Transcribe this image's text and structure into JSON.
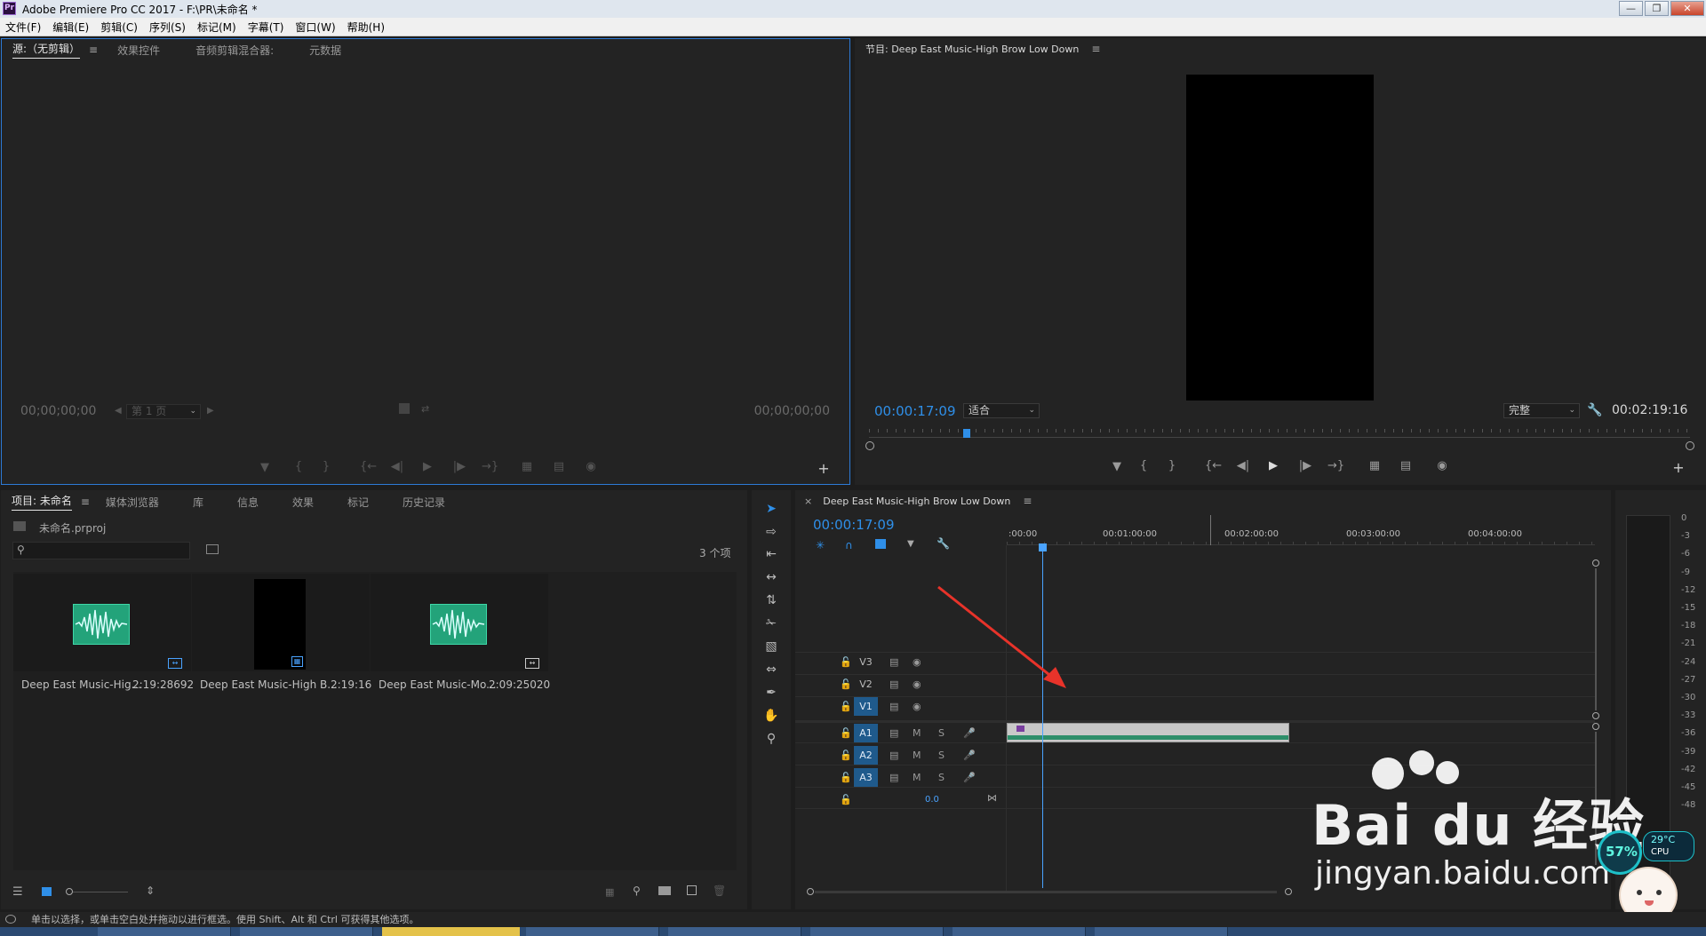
{
  "window": {
    "title": "Adobe Premiere Pro CC 2017 - F:\\PR\\未命名 *",
    "app_icon": "Pr"
  },
  "menu": [
    "文件(F)",
    "编辑(E)",
    "剪辑(C)",
    "序列(S)",
    "标记(M)",
    "字幕(T)",
    "窗口(W)",
    "帮助(H)"
  ],
  "source_panel": {
    "tabs": [
      "源:（无剪辑）",
      "效果控件",
      "音频剪辑混合器:",
      "元数据"
    ],
    "timecode_left": "00;00;00;00",
    "timecode_right": "00;00;00;00",
    "page_dropdown": "第 1 页"
  },
  "program_panel": {
    "title": "节目: Deep East Music-High Brow Low Down",
    "timecode_current": "00:00:17:09",
    "zoom": "适合",
    "quality": "完整",
    "duration": "00:02:19:16"
  },
  "project_panel": {
    "tabs": [
      "项目: 未命名",
      "媒体浏览器",
      "库",
      "信息",
      "效果",
      "标记",
      "历史记录"
    ],
    "project_file": "未命名.prproj",
    "item_count": "3 个项",
    "items": [
      {
        "name": "Deep East Music-Hig...",
        "duration": "2:19:28692",
        "kind": "audio"
      },
      {
        "name": "Deep East Music-High B...",
        "duration": "2:19:16",
        "kind": "sequence"
      },
      {
        "name": "Deep East Music-Mo...",
        "duration": "2:09:25020",
        "kind": "audio"
      }
    ]
  },
  "timeline": {
    "title": "Deep East Music-High Brow Low Down",
    "timecode": "00:00:17:09",
    "ruler": [
      ":00:00",
      "00:01:00:00",
      "00:02:00:00",
      "00:03:00:00",
      "00:04:00:00"
    ],
    "video_tracks": [
      "V3",
      "V2",
      "V1"
    ],
    "audio_tracks": [
      "A1",
      "A2",
      "A3"
    ],
    "audio_buttons": {
      "mute": "M",
      "solo": "S"
    },
    "master_value": "0.0",
    "playhead_fraction": 0.06
  },
  "audio_meter": {
    "labels": [
      "0",
      "-3",
      "-6",
      "-9",
      "-12",
      "-15",
      "-18",
      "-21",
      "-24",
      "-27",
      "-30",
      "-33",
      "-36",
      "-39",
      "-42",
      "-45",
      "-48"
    ]
  },
  "status": "单击以选择，或单击空白处并拖动以进行框选。使用 Shift、Alt 和 Ctrl 可获得其他选项。",
  "watermark": {
    "brand": "Bai du 经验",
    "url": "jingyan.baidu.com"
  },
  "overlay": {
    "cpu_percent": "57%",
    "temperature": "29°C",
    "cpu_label": "CPU"
  },
  "colors": {
    "accent": "#2f8fe8",
    "clip_audio": "#2e8f6a",
    "track_on": "#1f5a8c",
    "arrow": "#e8332a"
  }
}
